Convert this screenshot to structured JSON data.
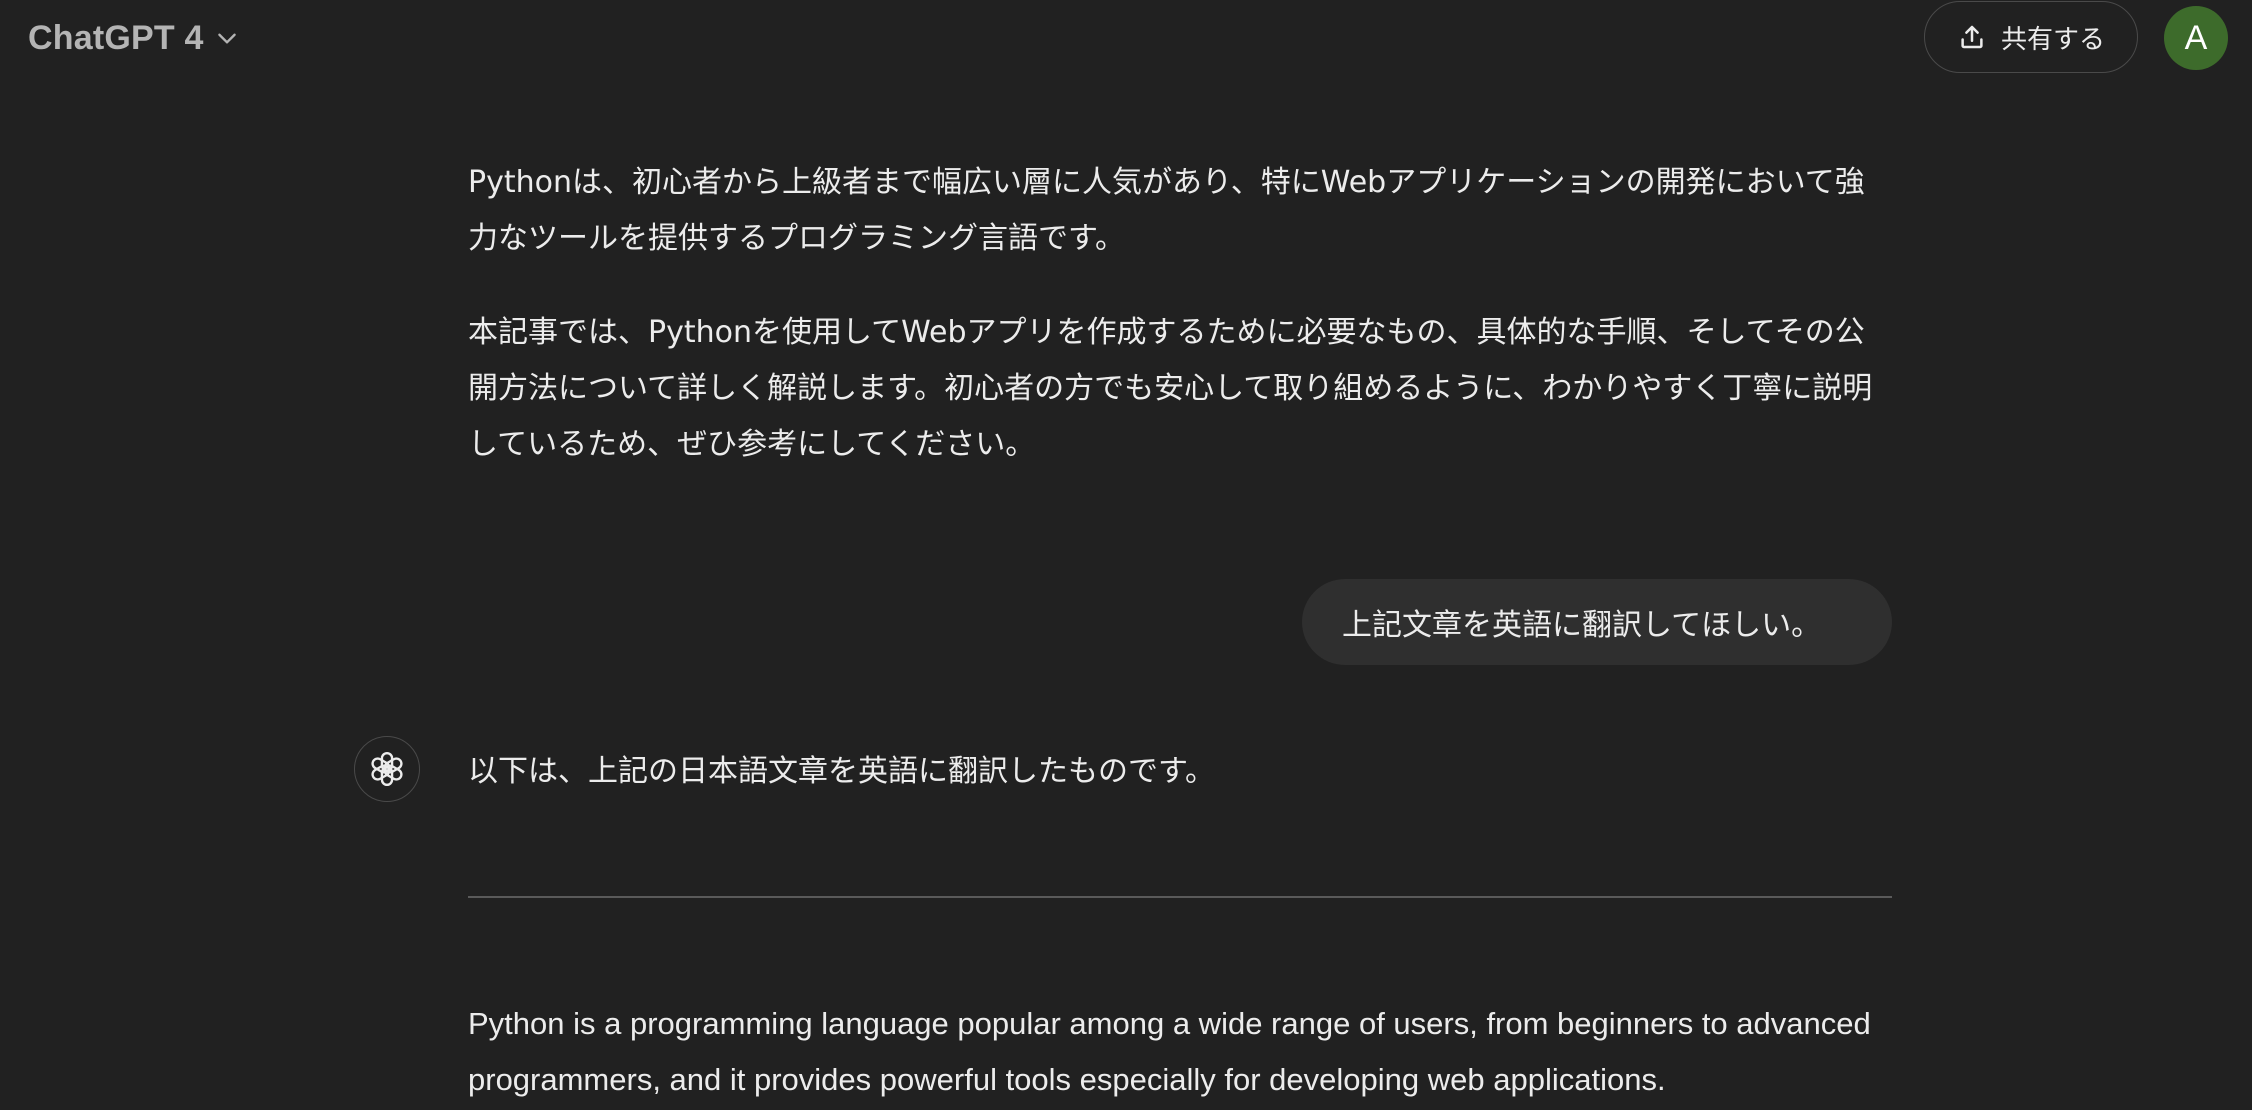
{
  "header": {
    "model_name": "ChatGPT 4",
    "share_label": "共有する",
    "avatar_initial": "A"
  },
  "conversation": {
    "prev_assistant_paragraphs": [
      "Pythonは、初心者から上級者まで幅広い層に人気があり、特にWebアプリケーションの開発において強力なツールを提供するプログラミング言語です。",
      "本記事では、Pythonを使用してWebアプリを作成するために必要なもの、具体的な手順、そしてその公開方法について詳しく解説します。初心者の方でも安心して取り組めるように、わかりやすく丁寧に説明しているため、ぜひ参考にしてください。"
    ],
    "user_message": "上記文章を英語に翻訳してほしい。",
    "assistant_intro": "以下は、上記の日本語文章を英語に翻訳したものです。",
    "assistant_translation": "Python is a programming language popular among a wide range of users, from beginners to advanced programmers, and it provides powerful tools especially for developing web applications."
  },
  "colors": {
    "background": "#212121",
    "text": "#ececec",
    "muted": "#b4b4b4",
    "bubble": "#2f2f2f",
    "avatar": "#3d6b2b",
    "border": "#4a4a4a"
  },
  "icons": {
    "model_dropdown": "chevron-down-icon",
    "share": "share-upload-icon",
    "assistant": "openai-logo-icon"
  }
}
